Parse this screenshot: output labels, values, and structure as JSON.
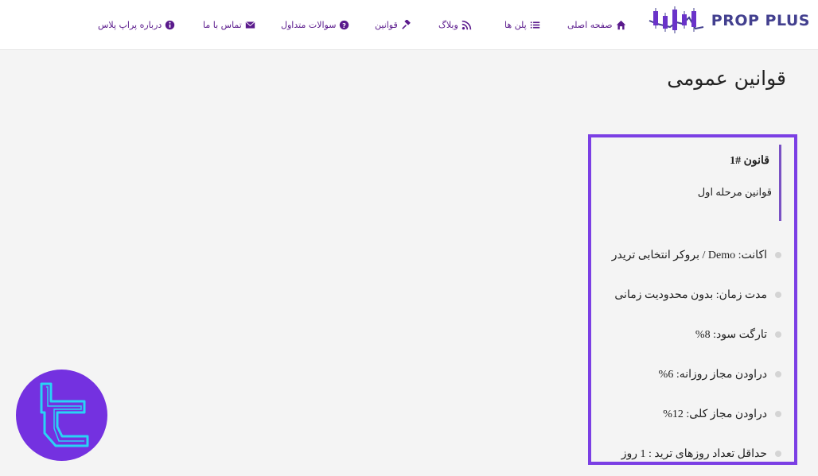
{
  "brand": {
    "name": "PROP PLUS"
  },
  "nav": [
    {
      "label": "صفحه اصلی",
      "icon": "home-icon"
    },
    {
      "label": "پلن ها",
      "icon": "list-icon"
    },
    {
      "label": "وبلاگ",
      "icon": "rss-icon"
    },
    {
      "label": "قوانین",
      "icon": "gavel-icon"
    },
    {
      "label": "سوالات متداول",
      "icon": "question-circle-icon"
    },
    {
      "label": "تماس با ما",
      "icon": "envelope-icon"
    },
    {
      "label": "درباره پراپ پلاس",
      "icon": "info-circle-icon"
    }
  ],
  "page": {
    "title": "قوانین عمومی"
  },
  "rule": {
    "title": "قانون #1",
    "subtitle": "قوانین مرحله اول",
    "items": [
      "اکانت: Demo / بروکر انتخابی تریدر",
      "مدت زمان: بدون محدودیت زمانی",
      "تارگت سود: 8%",
      "دراودن مجاز روزانه: 6%",
      "دراودن مجاز کلی: 12%",
      "حداقل تعداد روزهای ترید : 1 روز"
    ]
  },
  "colors": {
    "accent": "#7b3fe4",
    "nav_text": "#5a1a8c",
    "logo_text": "#43408f",
    "badge": "#7431e0",
    "badge_logo": "#29d3f5"
  }
}
